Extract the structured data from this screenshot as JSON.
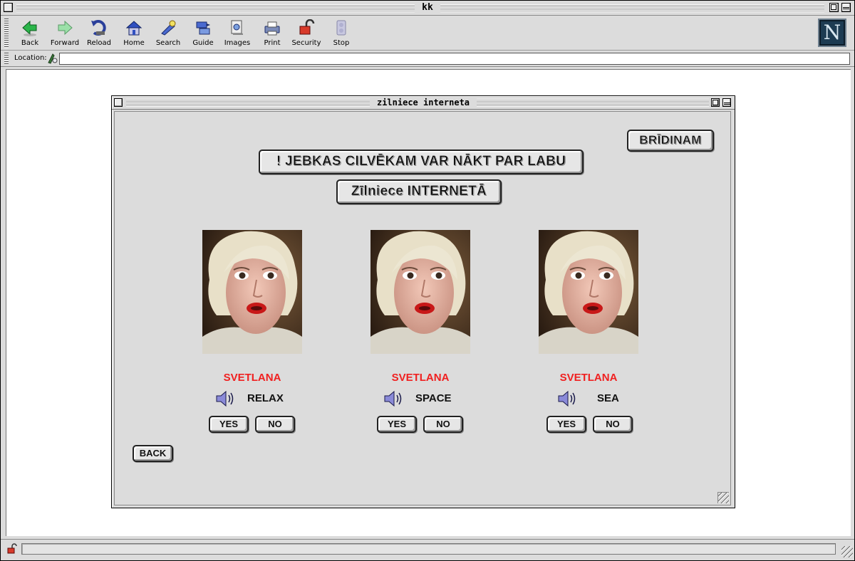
{
  "window": {
    "title": "kk"
  },
  "toolbar": {
    "buttons": [
      {
        "label": "Back",
        "icon": "back-arrow-icon"
      },
      {
        "label": "Forward",
        "icon": "forward-arrow-icon"
      },
      {
        "label": "Reload",
        "icon": "reload-icon"
      },
      {
        "label": "Home",
        "icon": "home-icon"
      },
      {
        "label": "Search",
        "icon": "search-icon"
      },
      {
        "label": "Guide",
        "icon": "guide-icon"
      },
      {
        "label": "Images",
        "icon": "images-icon"
      },
      {
        "label": "Print",
        "icon": "print-icon"
      },
      {
        "label": "Security",
        "icon": "padlock-icon"
      },
      {
        "label": "Stop",
        "icon": "stop-icon"
      }
    ],
    "logo_letter": "N"
  },
  "location": {
    "label": "Location:",
    "value": ""
  },
  "inner_window": {
    "title": "zilniece interneta"
  },
  "page": {
    "warn_button": "BRĪDINAM",
    "headline_button": "! JEBKAS CILVĒKAM VAR NĀKT PAR LABU",
    "sub_button": "Zīlniece INTERNETĀ",
    "cards": [
      {
        "name": "SVETLANA",
        "sound": "RELAX",
        "yes": "YES",
        "no": "NO"
      },
      {
        "name": "SVETLANA",
        "sound": "SPACE",
        "yes": "YES",
        "no": "NO"
      },
      {
        "name": "SVETLANA",
        "sound": "SEA",
        "yes": "YES",
        "no": "NO"
      }
    ],
    "back_button": "BACK"
  },
  "status": {
    "text": ""
  },
  "colors": {
    "name_red": "#f02020",
    "chrome_gray": "#dcdcdc"
  }
}
